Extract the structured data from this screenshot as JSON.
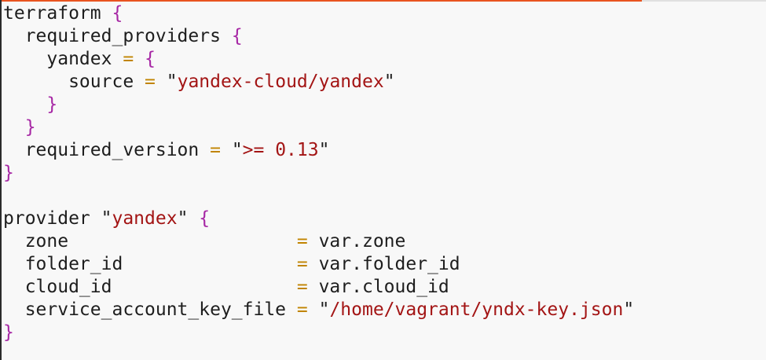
{
  "editor": {
    "colors": {
      "background": "#f8f8f8",
      "text": "#1e1e1e",
      "punctuation": "#a626a4",
      "operator": "#c18401",
      "string": "#a31515",
      "accent": "#e95420"
    },
    "lines": [
      [
        {
          "t": "terraform",
          "c": "id"
        },
        {
          "t": " ",
          "c": "ws"
        },
        {
          "t": "{",
          "c": "punc"
        }
      ],
      [
        {
          "t": "  required_providers",
          "c": "id"
        },
        {
          "t": " ",
          "c": "ws"
        },
        {
          "t": "{",
          "c": "punc"
        }
      ],
      [
        {
          "t": "    yandex",
          "c": "id"
        },
        {
          "t": " ",
          "c": "ws"
        },
        {
          "t": "=",
          "c": "op"
        },
        {
          "t": " ",
          "c": "ws"
        },
        {
          "t": "{",
          "c": "punc"
        }
      ],
      [
        {
          "t": "      source",
          "c": "id"
        },
        {
          "t": " ",
          "c": "ws"
        },
        {
          "t": "=",
          "c": "op"
        },
        {
          "t": " \"",
          "c": "id"
        },
        {
          "t": "yandex-cloud/yandex",
          "c": "str"
        },
        {
          "t": "\"",
          "c": "id"
        }
      ],
      [
        {
          "t": "    ",
          "c": "ws"
        },
        {
          "t": "}",
          "c": "punc"
        }
      ],
      [
        {
          "t": "  ",
          "c": "ws"
        },
        {
          "t": "}",
          "c": "punc"
        }
      ],
      [
        {
          "t": "  required_version",
          "c": "id"
        },
        {
          "t": " ",
          "c": "ws"
        },
        {
          "t": "=",
          "c": "op"
        },
        {
          "t": " \"",
          "c": "id"
        },
        {
          "t": ">= 0.13",
          "c": "str"
        },
        {
          "t": "\"",
          "c": "id"
        }
      ],
      [
        {
          "t": "}",
          "c": "punc"
        }
      ],
      [],
      [
        {
          "t": "provider \"",
          "c": "id"
        },
        {
          "t": "yandex",
          "c": "str"
        },
        {
          "t": "\" ",
          "c": "id"
        },
        {
          "t": "{",
          "c": "punc"
        }
      ],
      [
        {
          "t": "  zone                     ",
          "c": "id"
        },
        {
          "t": "=",
          "c": "op"
        },
        {
          "t": " var.zone",
          "c": "id"
        }
      ],
      [
        {
          "t": "  folder_id                ",
          "c": "id"
        },
        {
          "t": "=",
          "c": "op"
        },
        {
          "t": " var.folder_id",
          "c": "id"
        }
      ],
      [
        {
          "t": "  cloud_id                 ",
          "c": "id"
        },
        {
          "t": "=",
          "c": "op"
        },
        {
          "t": " var.cloud_id",
          "c": "id"
        }
      ],
      [
        {
          "t": "  service_account_key_file ",
          "c": "id"
        },
        {
          "t": "=",
          "c": "op"
        },
        {
          "t": " \"",
          "c": "id"
        },
        {
          "t": "/home/vagrant/yndx-key.json",
          "c": "str"
        },
        {
          "t": "\"",
          "c": "id"
        }
      ],
      [
        {
          "t": "}",
          "c": "punc"
        }
      ]
    ]
  }
}
